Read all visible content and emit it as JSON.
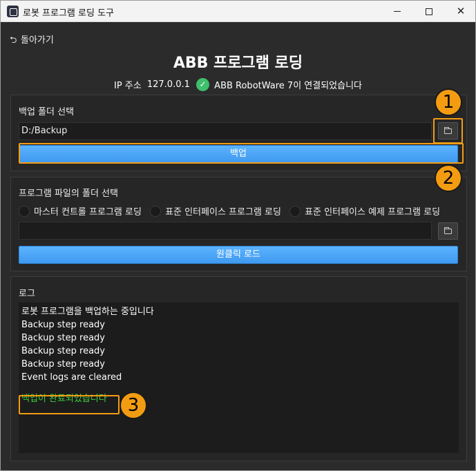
{
  "window": {
    "title": "로봇 프로그램 로딩 도구"
  },
  "nav": {
    "back_label": "돌아가기"
  },
  "header": {
    "title": "ABB 프로그램 로딩",
    "ip_label": "IP 주소",
    "ip_value": "127.0.0.1",
    "connection_status": "ABB RobotWare 7이 연결되었습니다",
    "status_color": "#3fbf6c"
  },
  "backup": {
    "label": "백업 폴더 선택",
    "folder_path": "D:/Backup",
    "backup_button": "백업"
  },
  "program": {
    "label": "프로그램 파일의 폴더 선택",
    "options": [
      "마스터 컨트롤 프로그램 로딩",
      "표준 인터페이스 프로그램 로딩",
      "표준 인터페이스 예제 프로그램 로딩"
    ],
    "folder_path": "",
    "load_button": "원클릭 로드"
  },
  "log": {
    "label": "로그",
    "lines": [
      "로봇 프로그램을 백업하는 중입니다",
      "Backup step ready",
      "Backup step ready",
      "Backup step ready",
      "Backup step ready",
      "Event logs are cleared"
    ],
    "success_line": "백업이 완료되었습니다",
    "success_color": "#3ccf3c"
  },
  "annotations": [
    "1",
    "2",
    "3"
  ],
  "accent": "#f39c12",
  "button_color": "#4aa6f7"
}
